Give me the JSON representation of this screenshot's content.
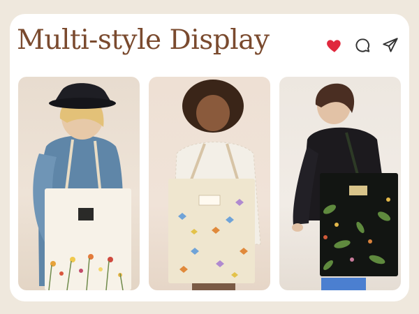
{
  "title": "Multi-style Display",
  "actions": [
    {
      "name": "like",
      "icon": "heart-icon",
      "color": "#e0283d"
    },
    {
      "name": "comment",
      "icon": "speech-bubble-icon",
      "color": "#333333"
    },
    {
      "name": "share",
      "icon": "paper-plane-icon",
      "color": "#333333"
    }
  ],
  "panels": [
    {
      "style": "white tote with wildflower print"
    },
    {
      "style": "beige tote with butterfly print"
    },
    {
      "style": "black tote with botanical print"
    }
  ],
  "colors": {
    "title": "#7a4a2e",
    "background": "#efe8dd",
    "card": "#ffffff"
  }
}
